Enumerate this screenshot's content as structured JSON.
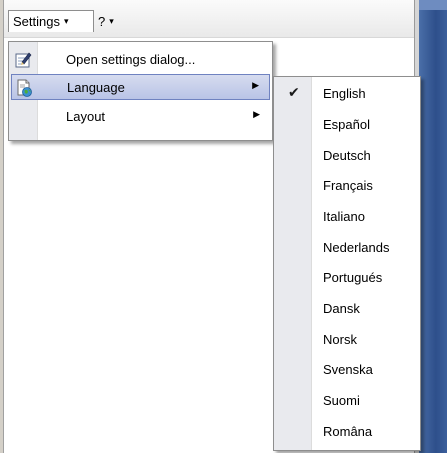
{
  "toolbar": {
    "settings_label": "Settings",
    "help_label": "?",
    "dropdown_arrow": "▾"
  },
  "settings_menu": {
    "items": [
      {
        "label": "Open settings dialog...",
        "icon": "edit-settings-icon",
        "has_submenu": false
      },
      {
        "label": "Language",
        "icon": "language-globe-icon",
        "has_submenu": true,
        "highlighted": true
      },
      {
        "label": "Layout",
        "icon": "",
        "has_submenu": true
      }
    ],
    "submenu_arrow": "▶"
  },
  "language_submenu": {
    "checkmark": "✔",
    "selected": "English",
    "items": [
      "English",
      "Español",
      "Deutsch",
      "Français",
      "Italiano",
      "Nederlands",
      "Portugués",
      "Dansk",
      "Norsk",
      "Svenska",
      "Suomi",
      "Româna"
    ]
  },
  "colors": {
    "highlight_fill": "#c4cdea",
    "highlight_border": "#6f82c0",
    "gutter": "#e9eaee",
    "side_panel": "#2e4f8b"
  }
}
